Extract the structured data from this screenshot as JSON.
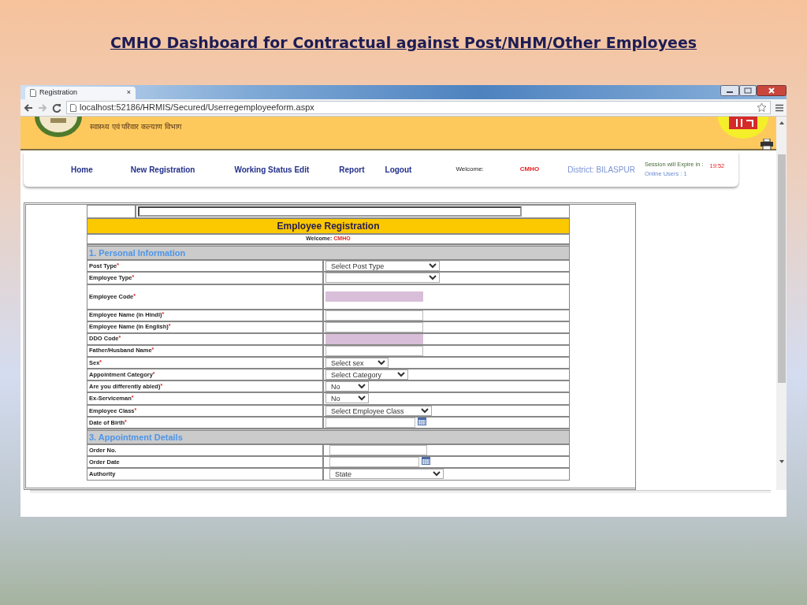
{
  "slide": {
    "title": "CMHO Dashboard  for  Contractual against Post/NHM/Other Employees"
  },
  "browser": {
    "tab_title": "Registration",
    "tab_close": "×",
    "url": "localhost:52186/HRMIS/Secured/Userregemployeeform.aspx"
  },
  "page": {
    "header_text": "स्वास्थ्य एवं परिवार कल्याण विभाग",
    "nav": [
      {
        "label": "Home"
      },
      {
        "label": "New Registration"
      },
      {
        "label": "Working Status Edit"
      },
      {
        "label": "Report"
      },
      {
        "label": "Logout"
      }
    ],
    "welcome_label": "Welcome:",
    "user": "CMHO",
    "district": "District: BILASPUR",
    "session_label": "Session will Expire in :",
    "session_time": "19:52",
    "online_users": "Online Users : 1"
  },
  "form": {
    "title": "Employee Registration",
    "welcome_label": "Welcome:",
    "welcome_user": "CMHO",
    "sections": [
      {
        "title": "1. Personal Information",
        "rows": [
          {
            "label": "Post Type",
            "required_mark": "*",
            "kind": "select",
            "value": "Select Post Type"
          },
          {
            "label": "Employee Type",
            "required_mark": "*",
            "kind": "select",
            "value": ""
          },
          {
            "label": "Employee Code",
            "required_mark": "*",
            "kind": "text",
            "locked": true,
            "tall": true
          },
          {
            "label": "Employee Name (in Hindi)",
            "required_mark": "*",
            "kind": "text",
            "locked": false
          },
          {
            "label": "Employee Name (in English)",
            "required_mark": "*",
            "kind": "text",
            "locked": false
          },
          {
            "label": "DDO Code",
            "required_mark": "*",
            "kind": "text",
            "locked": true
          },
          {
            "label": "Father/Husband Name",
            "required_mark": "*",
            "kind": "text",
            "locked": false
          },
          {
            "label": "Sex",
            "required_mark": "*",
            "kind": "select",
            "value": "Select sex"
          },
          {
            "label": "Appointment Category",
            "required_mark": "*",
            "kind": "select",
            "value": "Select Category"
          },
          {
            "label": "Are you differently abled)",
            "required_mark": "*",
            "kind": "select",
            "value": "No"
          },
          {
            "label": "Ex-Serviceman",
            "required_mark": "*",
            "kind": "select",
            "value": "No"
          },
          {
            "label": "Employee Class",
            "required_mark": "*",
            "kind": "select",
            "value": "Select Employee Class"
          },
          {
            "label": "Date of Birth",
            "required_mark": "*",
            "kind": "date"
          }
        ]
      },
      {
        "title": "3. Appointment Details",
        "rows": [
          {
            "label": "Order No.",
            "kind": "text",
            "locked": false
          },
          {
            "label": "Order Date",
            "kind": "date"
          },
          {
            "label": "Authority",
            "kind": "select",
            "value": "State"
          }
        ]
      }
    ]
  }
}
